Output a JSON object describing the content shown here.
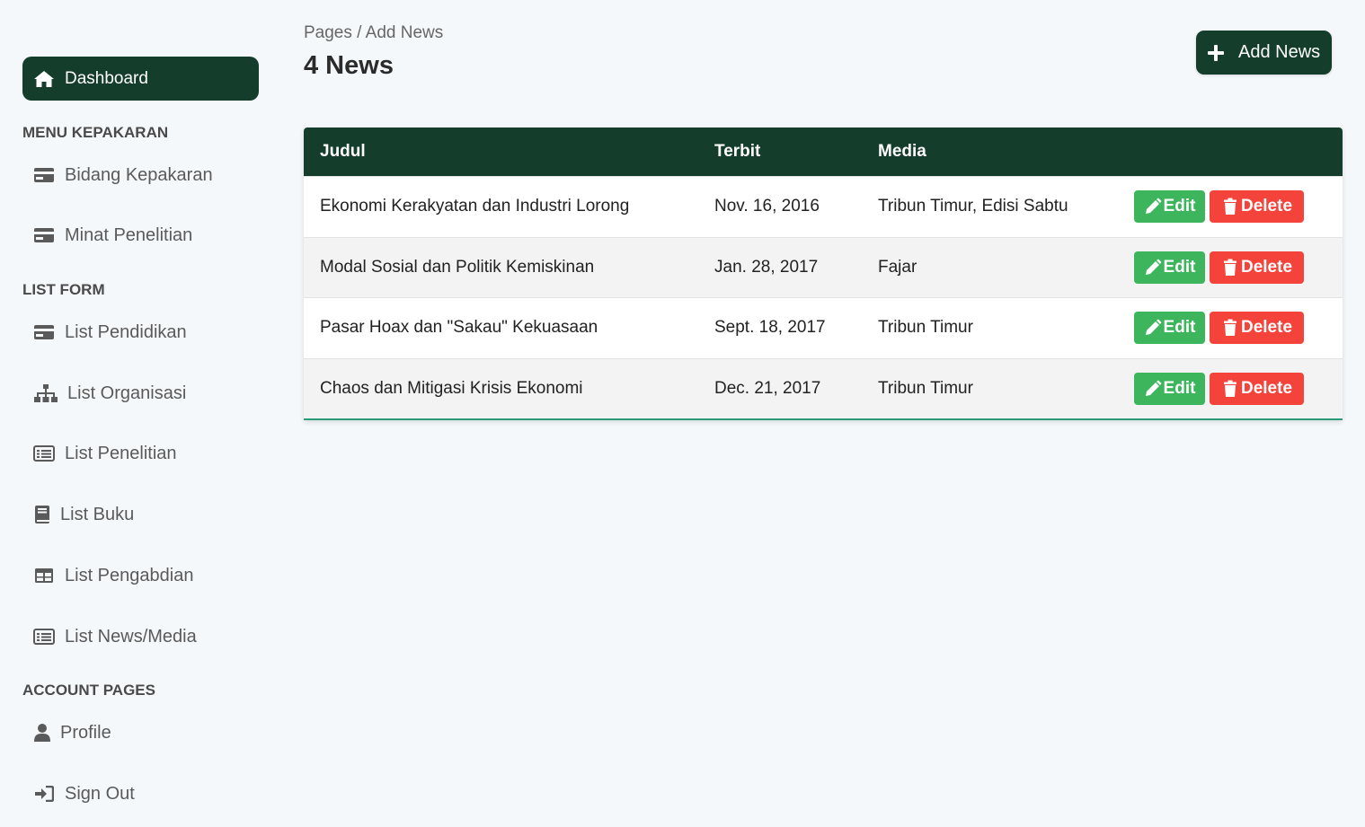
{
  "breadcrumb": "Pages / Add News",
  "page_title": "4 News",
  "add_button": "Add News",
  "sidebar": {
    "dashboard": "Dashboard",
    "sections": [
      "MENU KEPAKARAN",
      "LIST FORM",
      "ACCOUNT PAGES"
    ],
    "items": [
      {
        "label": "Bidang Kepakaran",
        "icon": "card-icon"
      },
      {
        "label": "Minat Penelitian",
        "icon": "card-icon"
      },
      {
        "label": "List Pendidikan",
        "icon": "card-icon"
      },
      {
        "label": "List Organisasi",
        "icon": "sitemap-icon"
      },
      {
        "label": "List Penelitian",
        "icon": "list-alt-icon"
      },
      {
        "label": "List Buku",
        "icon": "book-icon"
      },
      {
        "label": "List Pengabdian",
        "icon": "table-icon"
      },
      {
        "label": "List News/Media",
        "icon": "list-alt-icon"
      },
      {
        "label": "Profile",
        "icon": "user-icon"
      },
      {
        "label": "Sign Out",
        "icon": "sign-in-icon"
      }
    ]
  },
  "table": {
    "headers": [
      "Judul",
      "Terbit",
      "Media",
      ""
    ],
    "rows": [
      {
        "judul": "Ekonomi Kerakyatan dan Industri Lorong",
        "terbit": "Nov. 16, 2016",
        "media": "Tribun Timur, Edisi Sabtu"
      },
      {
        "judul": "Modal Sosial dan Politik Kemiskinan",
        "terbit": "Jan. 28, 2017",
        "media": "Fajar"
      },
      {
        "judul": "Pasar Hoax dan \"Sakau\" Kekuasaan",
        "terbit": "Sept. 18, 2017",
        "media": "Tribun Timur"
      },
      {
        "judul": "Chaos dan Mitigasi Krisis Ekonomi",
        "terbit": "Dec. 21, 2017",
        "media": "Tribun Timur"
      }
    ],
    "edit_label": "Edit",
    "delete_label": "Delete"
  },
  "colors": {
    "primary": "#143d2b",
    "edit": "#3cb55c",
    "delete": "#f4433b",
    "accent_line": "#2a9b76",
    "background": "#f5f8fb"
  }
}
